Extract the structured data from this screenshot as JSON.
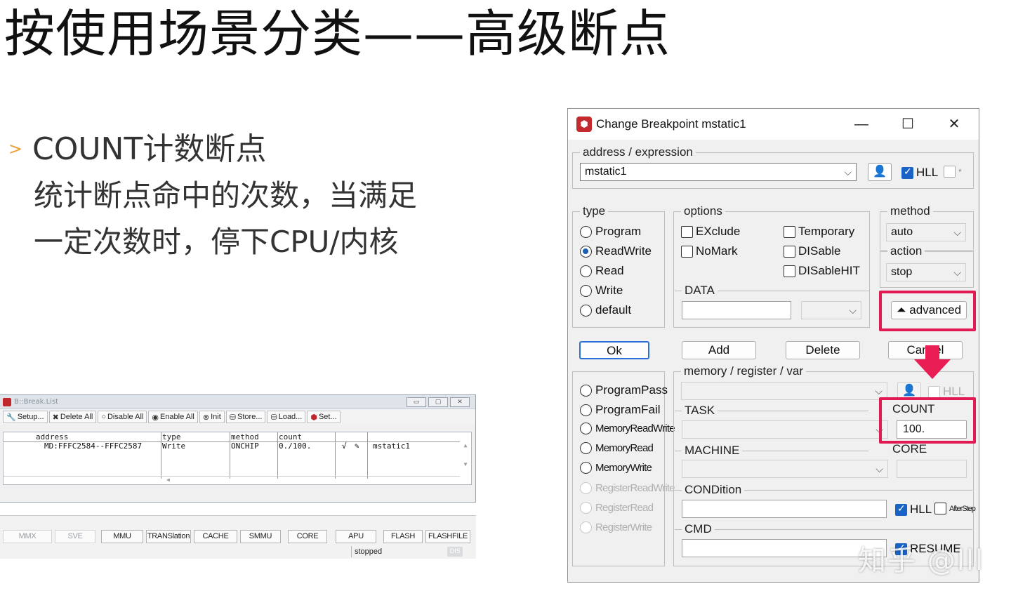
{
  "slide": {
    "title": "按使用场景分类——高级断点",
    "bullet_marker": ">",
    "bullet_heading": "COUNT计数断点",
    "bullet_lines": [
      "统计断点命中的次数，当满足",
      "一定次数时，停下CPU/内核"
    ]
  },
  "break_list": {
    "window_title": "B::Break.List",
    "window_buttons": [
      "▭",
      "▢",
      "✕"
    ],
    "toolbar": [
      {
        "icon": "wrench-icon",
        "glyph": "🔧",
        "label": "Setup..."
      },
      {
        "icon": "delete-x-icon",
        "glyph": "✖",
        "label": "Delete All"
      },
      {
        "icon": "disable-circle-icon",
        "glyph": "○",
        "label": "Disable All"
      },
      {
        "icon": "enable-circle-icon",
        "glyph": "◉",
        "label": "Enable All"
      },
      {
        "icon": "init-icon",
        "glyph": "⊗",
        "label": "Init"
      },
      {
        "icon": "store-icon",
        "glyph": "⛁",
        "label": "Store..."
      },
      {
        "icon": "load-icon",
        "glyph": "⛁",
        "label": "Load..."
      },
      {
        "icon": "set-breakpoint-icon",
        "glyph": "⬢",
        "label": "Set..."
      }
    ],
    "columns": [
      "address",
      "type",
      "method",
      "count"
    ],
    "row": {
      "address": "MD:FFFC2584--FFFC2587",
      "type": "Write",
      "method": "ONCHIP",
      "count": "0./100.",
      "check": "√",
      "edit": "✎",
      "symbol": "mstatic1"
    }
  },
  "status_bar": {
    "tabs": [
      {
        "label": "MMX",
        "dim": true
      },
      {
        "label": "SVE",
        "dim": true
      },
      {
        "label": "MMU",
        "dim": false
      },
      {
        "label": "TRANSlation",
        "dim": false
      },
      {
        "label": "CACHE",
        "dim": false
      },
      {
        "label": "SMMU",
        "dim": false
      },
      {
        "label": "CORE",
        "dim": false
      },
      {
        "label": "APU",
        "dim": false
      },
      {
        "label": "FLASH",
        "dim": false
      },
      {
        "label": "FLASHFILE",
        "dim": false
      }
    ],
    "state": "stopped",
    "dis_badge": "DIS"
  },
  "dialog": {
    "title": "Change Breakpoint  mstatic1",
    "controls": {
      "minimize": "—",
      "maximize": "☐",
      "close": "✕"
    },
    "address_group": "address / expression",
    "address_value": "mstatic1",
    "hll_label": "HLL",
    "star_label": "*",
    "type_group": "type",
    "types": [
      {
        "label": "Program",
        "selected": false
      },
      {
        "label": "ReadWrite",
        "selected": true
      },
      {
        "label": "Read",
        "selected": false
      },
      {
        "label": "Write",
        "selected": false
      },
      {
        "label": "default",
        "selected": false
      }
    ],
    "options_group": "options",
    "options": [
      "EXclude",
      "Temporary",
      "NoMark",
      "DISable",
      "DISableHIT"
    ],
    "data_group": "DATA",
    "method_group": "method",
    "method_value": "auto",
    "action_group": "action",
    "action_value": "stop",
    "advanced_label": "advanced",
    "buttons": {
      "ok": "Ok",
      "add": "Add",
      "delete": "Delete",
      "cancel": "Cancel"
    },
    "conditions": [
      {
        "label": "ProgramPass",
        "dim": false,
        "condensed": false
      },
      {
        "label": "ProgramFail",
        "dim": false,
        "condensed": false
      },
      {
        "label": "MemoryReadWrite",
        "dim": false,
        "condensed": true
      },
      {
        "label": "MemoryRead",
        "dim": false,
        "condensed": true
      },
      {
        "label": "MemoryWrite",
        "dim": false,
        "condensed": true
      },
      {
        "label": "RegisterReadWrite",
        "dim": true,
        "condensed": true
      },
      {
        "label": "RegisterRead",
        "dim": true,
        "condensed": true
      },
      {
        "label": "RegisterWrite",
        "dim": true,
        "condensed": true
      }
    ],
    "memory_group": "memory / register / var",
    "hll2_label": "HLL",
    "task_group": "TASK",
    "count_group": "COUNT",
    "count_value": "100.",
    "machine_group": "MACHINE",
    "core_group": "CORE",
    "condition_group": "CONDition",
    "hll3_label": "HLL",
    "afterstep_label": "AfterStep",
    "cmd_group": "CMD",
    "resume_label": "RESUME"
  },
  "watermark": "知乎 @lll",
  "colors": {
    "highlight": "#e21a53",
    "accent": "#1a63c6",
    "bullet": "#e8a23a"
  }
}
